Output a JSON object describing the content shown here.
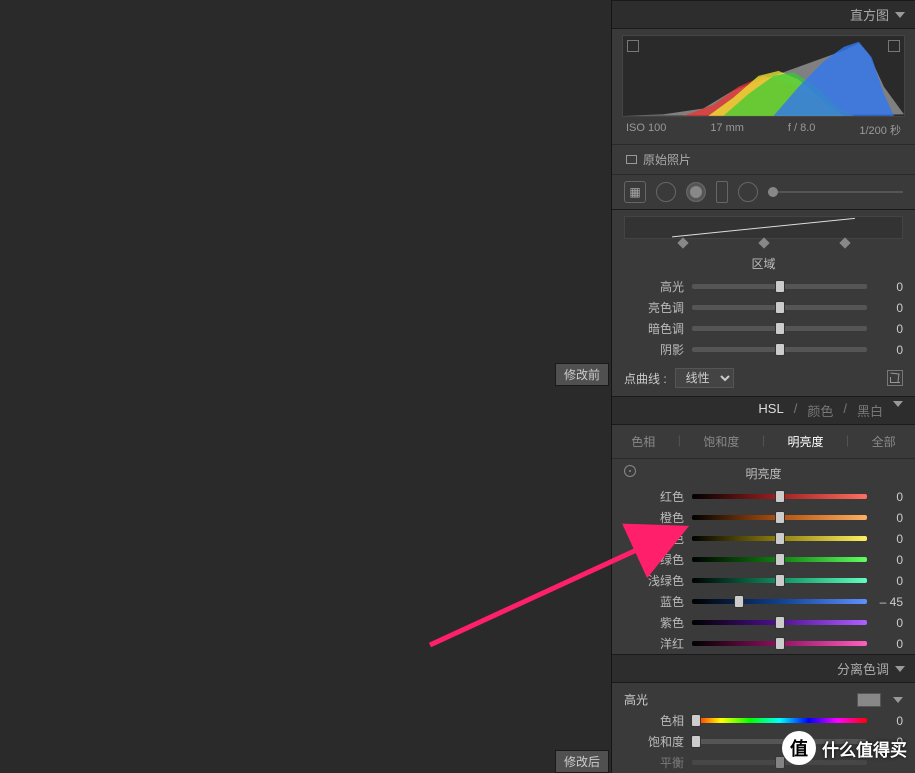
{
  "preview": {
    "before_label": "修改前",
    "after_label": "修改后"
  },
  "panels": {
    "histogram_title": "直方图",
    "histo_info": {
      "iso": "ISO 100",
      "focal": "17 mm",
      "aperture": "f / 8.0",
      "shutter": "1/200 秒"
    },
    "original_photo": "原始照片",
    "region_title": "区域",
    "region_sliders": [
      {
        "label": "高光",
        "value": 0
      },
      {
        "label": "亮色调",
        "value": 0
      },
      {
        "label": "暗色调",
        "value": 0
      },
      {
        "label": "阴影",
        "value": 0
      }
    ],
    "point_curve_label": "点曲线 :",
    "point_curve_value": "线性",
    "hsl": {
      "hsl": "HSL",
      "color": "颜色",
      "bw": "黑白"
    },
    "hsl_tabs": {
      "hue": "色相",
      "sat": "饱和度",
      "lum": "明亮度",
      "all": "全部"
    },
    "lum_title": "明亮度",
    "lum_sliders": [
      {
        "label": "红色",
        "value": 0,
        "grad": "grad-r",
        "pos": 50
      },
      {
        "label": "橙色",
        "value": 0,
        "grad": "grad-o",
        "pos": 50
      },
      {
        "label": "黄色",
        "value": 0,
        "grad": "grad-y",
        "pos": 50
      },
      {
        "label": "绿色",
        "value": 0,
        "grad": "grad-g",
        "pos": 50
      },
      {
        "label": "浅绿色",
        "value": 0,
        "grad": "grad-a",
        "pos": 50
      },
      {
        "label": "蓝色",
        "value": -45,
        "display": "– 45",
        "grad": "grad-b",
        "pos": 27
      },
      {
        "label": "紫色",
        "value": 0,
        "grad": "grad-p",
        "pos": 50
      },
      {
        "label": "洋红",
        "value": 0,
        "grad": "grad-m",
        "pos": 50
      }
    ],
    "split_tone_title": "分离色调",
    "split": {
      "highlights": "高光",
      "hue": "色相",
      "hue_val": 0,
      "sat": "饱和度",
      "sat_val": 0,
      "balance": "平衡"
    }
  },
  "watermark": {
    "badge": "值",
    "text": "什么值得买"
  }
}
